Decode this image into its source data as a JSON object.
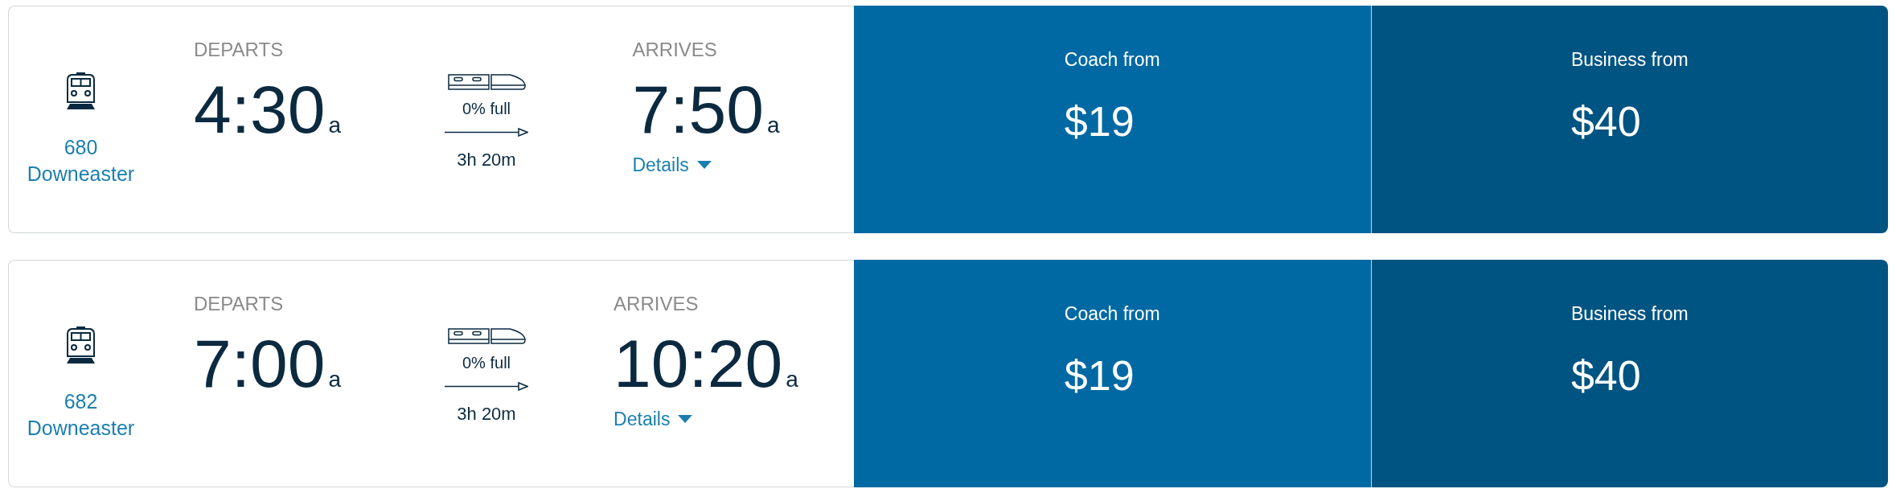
{
  "trips": [
    {
      "train_number": "680",
      "train_name": "Downeaster",
      "departs": {
        "label": "DEPARTS",
        "time": "4:30",
        "period": "a"
      },
      "capacity": "0% full",
      "duration": "3h 20m",
      "arrives": {
        "label": "ARRIVES",
        "time": "7:50",
        "period": "a"
      },
      "details": "Details",
      "fares": [
        {
          "kind": "coach",
          "label": "Coach from",
          "price": "$19"
        },
        {
          "kind": "business",
          "label": "Business from",
          "price": "$40"
        }
      ]
    },
    {
      "train_number": "682",
      "train_name": "Downeaster",
      "departs": {
        "label": "DEPARTS",
        "time": "7:00",
        "period": "a"
      },
      "capacity": "0% full",
      "duration": "3h 20m",
      "arrives": {
        "label": "ARRIVES",
        "time": "10:20",
        "period": "a"
      },
      "details": "Details",
      "fares": [
        {
          "kind": "coach",
          "label": "Coach from",
          "price": "$19"
        },
        {
          "kind": "business",
          "label": "Business from",
          "price": "$40"
        }
      ]
    }
  ]
}
